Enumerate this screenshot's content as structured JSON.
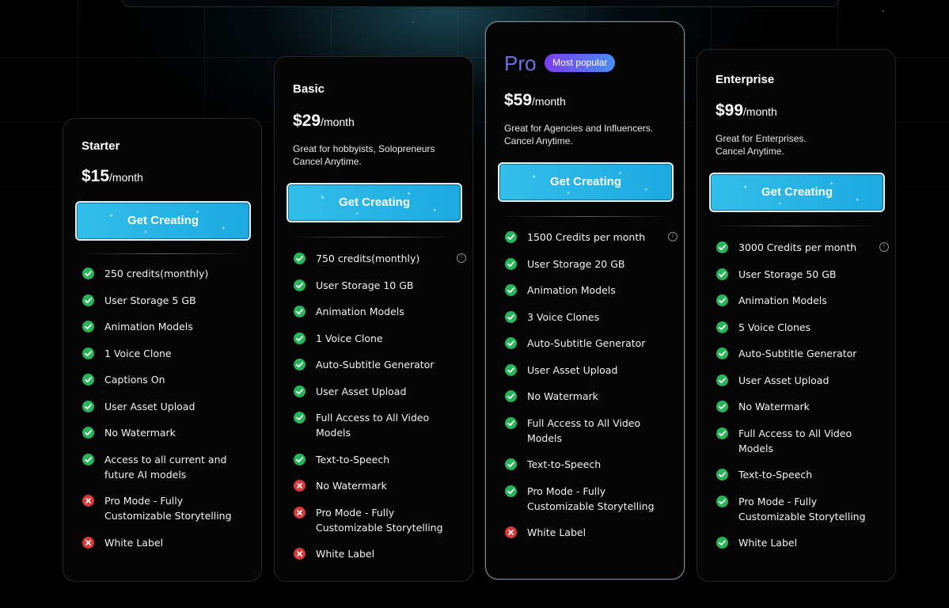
{
  "plans": [
    {
      "name": "Starter",
      "price": "$15",
      "period": "/month",
      "description": [],
      "cta": "Get Creating",
      "features": [
        {
          "text": "250 credits(monthly)",
          "included": true
        },
        {
          "text": "User Storage 5 GB",
          "included": true
        },
        {
          "text": "Animation Models",
          "included": true
        },
        {
          "text": "1 Voice Clone",
          "included": true
        },
        {
          "text": "Captions On",
          "included": true
        },
        {
          "text": "User Asset Upload",
          "included": true
        },
        {
          "text": "No Watermark",
          "included": true
        },
        {
          "text": "Access to all current and future AI models",
          "included": true
        },
        {
          "text": "Pro Mode - Fully Customizable Storytelling",
          "included": false
        },
        {
          "text": "White Label",
          "included": false
        }
      ]
    },
    {
      "name": "Basic",
      "price": "$29",
      "period": "/month",
      "description": [
        "Great for hobbyists, Solopreneurs",
        "Cancel Anytime."
      ],
      "cta": "Get Creating",
      "features": [
        {
          "text": "750 credits(monthly)",
          "included": true,
          "info": true
        },
        {
          "text": "User Storage 10 GB",
          "included": true
        },
        {
          "text": "Animation Models",
          "included": true
        },
        {
          "text": "1 Voice Clone",
          "included": true
        },
        {
          "text": "Auto-Subtitle Generator",
          "included": true
        },
        {
          "text": "User Asset Upload",
          "included": true
        },
        {
          "text": "Full Access to All Video Models",
          "included": true
        },
        {
          "text": "Text-to-Speech",
          "included": true
        },
        {
          "text": "No Watermark",
          "included": false
        },
        {
          "text": "Pro Mode - Fully Customizable Storytelling",
          "included": false
        },
        {
          "text": "White Label",
          "included": false
        }
      ]
    },
    {
      "name": "Pro",
      "badge": "Most popular",
      "price": "$59",
      "period": "/month",
      "description": [
        "Great for Agencies and Influencers.",
        "Cancel Anytime."
      ],
      "cta": "Get Creating",
      "features": [
        {
          "text": "1500 Credits per month",
          "included": true,
          "info": true
        },
        {
          "text": "User Storage 20 GB",
          "included": true
        },
        {
          "text": "Animation Models",
          "included": true
        },
        {
          "text": "3 Voice Clones",
          "included": true
        },
        {
          "text": "Auto-Subtitle Generator",
          "included": true
        },
        {
          "text": "User Asset Upload",
          "included": true
        },
        {
          "text": "No Watermark",
          "included": true
        },
        {
          "text": "Full Access to All Video Models",
          "included": true
        },
        {
          "text": "Text-to-Speech",
          "included": true
        },
        {
          "text": "Pro Mode - Fully Customizable Storytelling",
          "included": true
        },
        {
          "text": "White Label",
          "included": false
        }
      ]
    },
    {
      "name": "Enterprise",
      "price": "$99",
      "period": "/month",
      "description": [
        "Great for Enterprises.",
        "Cancel Anytime."
      ],
      "cta": "Get Creating",
      "features": [
        {
          "text": "3000 Credits per month",
          "included": true,
          "info": true
        },
        {
          "text": "User Storage 50 GB",
          "included": true
        },
        {
          "text": "Animation Models",
          "included": true
        },
        {
          "text": "5 Voice Clones",
          "included": true
        },
        {
          "text": "Auto-Subtitle Generator",
          "included": true
        },
        {
          "text": "User Asset Upload",
          "included": true
        },
        {
          "text": "No Watermark",
          "included": true
        },
        {
          "text": "Full Access to All Video Models",
          "included": true
        },
        {
          "text": "Text-to-Speech",
          "included": true
        },
        {
          "text": "Pro Mode - Fully Customizable Storytelling",
          "included": true
        },
        {
          "text": "White Label",
          "included": true
        }
      ]
    }
  ],
  "colors": {
    "background": "#000000",
    "card": "#050505",
    "cta": "#1ca9e0",
    "check": "#27b45a",
    "cross": "#d63a3a",
    "pro_accent": "#6f6fe0",
    "badge_gradient": [
      "#7a3ef0",
      "#4a8df2"
    ]
  },
  "icons": {
    "included": "check-circle-icon",
    "excluded": "x-circle-icon",
    "info": "info-icon"
  }
}
